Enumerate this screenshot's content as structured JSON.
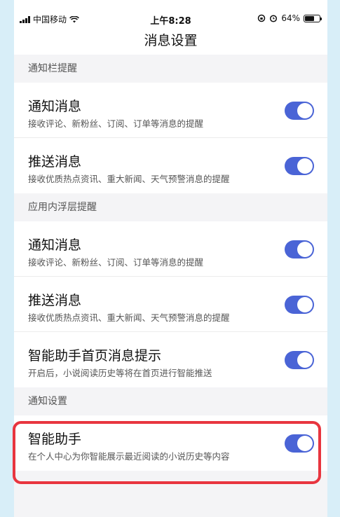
{
  "status_bar": {
    "carrier": "中国移动",
    "time": "上午8:28",
    "battery": "64%",
    "battery_level": 0.64
  },
  "header": {
    "title": "消息设置"
  },
  "sections": [
    {
      "header": "通知栏提醒",
      "items": [
        {
          "title": "通知消息",
          "desc": "接收评论、新粉丝、订阅、订单等消息的提醒",
          "enabled": true
        },
        {
          "title": "推送消息",
          "desc": "接收优质热点资讯、重大新闻、天气预警消息的提醒",
          "enabled": true
        }
      ]
    },
    {
      "header": "应用内浮层提醒",
      "items": [
        {
          "title": "通知消息",
          "desc": "接收评论、新粉丝、订阅、订单等消息的提醒",
          "enabled": true
        },
        {
          "title": "推送消息",
          "desc": "接收优质热点资讯、重大新闻、天气预警消息的提醒",
          "enabled": true
        },
        {
          "title": "智能助手首页消息提示",
          "desc": "开启后，小说阅读历史等将在首页进行智能推送",
          "enabled": true
        }
      ]
    },
    {
      "header": "通知设置",
      "items": [
        {
          "title": "智能助手",
          "desc": "在个人中心为你智能展示最近阅读的小说历史等内容",
          "enabled": true
        }
      ]
    }
  ],
  "colors": {
    "accent": "#4a64d6",
    "highlight": "#e8353f",
    "background": "#d8eef8"
  },
  "icons": [
    "signal-bars-icon",
    "wifi-icon",
    "rotation-lock-icon",
    "alarm-icon",
    "battery-icon"
  ]
}
